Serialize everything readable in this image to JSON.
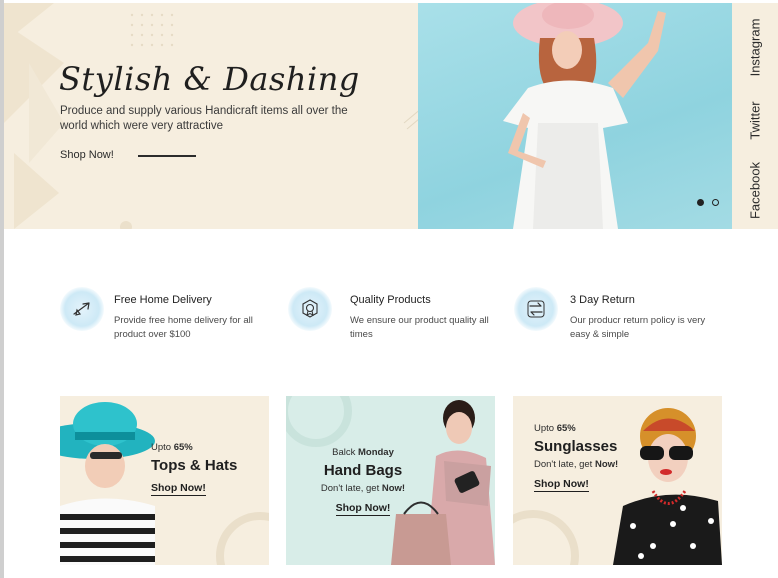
{
  "hero": {
    "title": "Stylish & Dashing",
    "subtitle": "Produce and supply various Handicraft items all over the world which were very attractive",
    "cta": "Shop Now!",
    "social": [
      "Instagram",
      "Twitter",
      "Facebook"
    ],
    "slides": {
      "current": 1,
      "total": 2
    }
  },
  "features": [
    {
      "icon": "delivery-plane-icon",
      "title": "Free Home Delivery",
      "desc": "Provide free home delivery for all product over $100"
    },
    {
      "icon": "quality-badge-icon",
      "title": "Quality Products",
      "desc": "We ensure our product quality all times"
    },
    {
      "icon": "return-arrows-icon",
      "title": "3 Day Return",
      "desc": "Our producr return policy is very easy & simple"
    }
  ],
  "cards": [
    {
      "pre_a": "Upto ",
      "pre_b": "65%",
      "title": "Tops & Hats",
      "sub_a": "",
      "sub_b": "",
      "link": "Shop Now!",
      "bg": "#f6eedf"
    },
    {
      "pre_a": "Balck ",
      "pre_b": "Monday",
      "title": "Hand Bags",
      "sub_a": "Don't late, get ",
      "sub_b": "Now!",
      "link": "Shop Now!",
      "bg": "#d8ede8"
    },
    {
      "pre_a": "Upto ",
      "pre_b": "65%",
      "title": "Sunglasses",
      "sub_a": "Don't late, get ",
      "sub_b": "Now!",
      "link": "Shop Now!",
      "bg": "#f6eedf"
    }
  ],
  "colors": {
    "cream": "#f6eedf",
    "sky": "#a3dbe4",
    "mint": "#d8ede8",
    "text": "#1f1f1f"
  }
}
